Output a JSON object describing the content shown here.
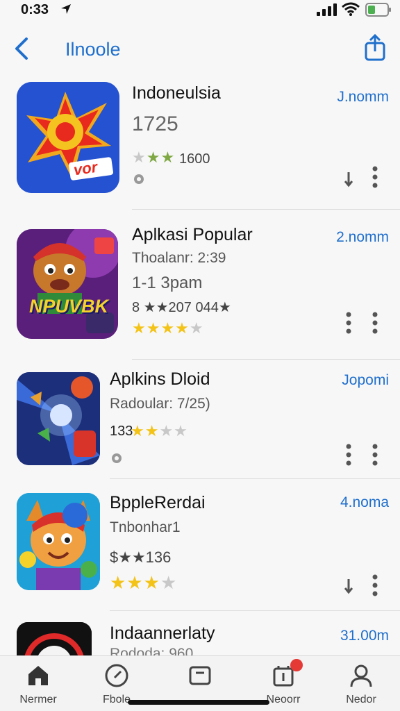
{
  "status": {
    "time": "0:33"
  },
  "nav": {
    "title": "Ilnoole"
  },
  "apps": [
    {
      "name": "Indoneulsia",
      "sub": "1725",
      "rating": "1600",
      "size": "J.nomm"
    },
    {
      "name": "Aplkasi Popular",
      "sub": "Thoalanr: 2:39",
      "sub2": "1-1 3pam",
      "rating": "8 ★★207 044★",
      "size": "2.nomm"
    },
    {
      "name": "Aplkins Dloid",
      "sub": "Radoular: 7/25)",
      "rating": "133",
      "size": "Jopomi"
    },
    {
      "name": "BppleRerdai",
      "sub": "Tnbonhar1",
      "rating": "$★★136",
      "size": "4.noma"
    },
    {
      "name": "Indaannerlaty",
      "sub": "Rododa: 960",
      "size": "31.00m"
    }
  ],
  "icons": {
    "app1": "vor",
    "app2": "NPUVBK"
  },
  "tabs": [
    {
      "label": "Nermer"
    },
    {
      "label": "Fbole"
    },
    {
      "label": ""
    },
    {
      "label": "Neoorr"
    },
    {
      "label": "Nedor"
    }
  ],
  "colors": {
    "accent": "#1f6fcc",
    "star": "#f3c318",
    "badge": "#e53935"
  }
}
